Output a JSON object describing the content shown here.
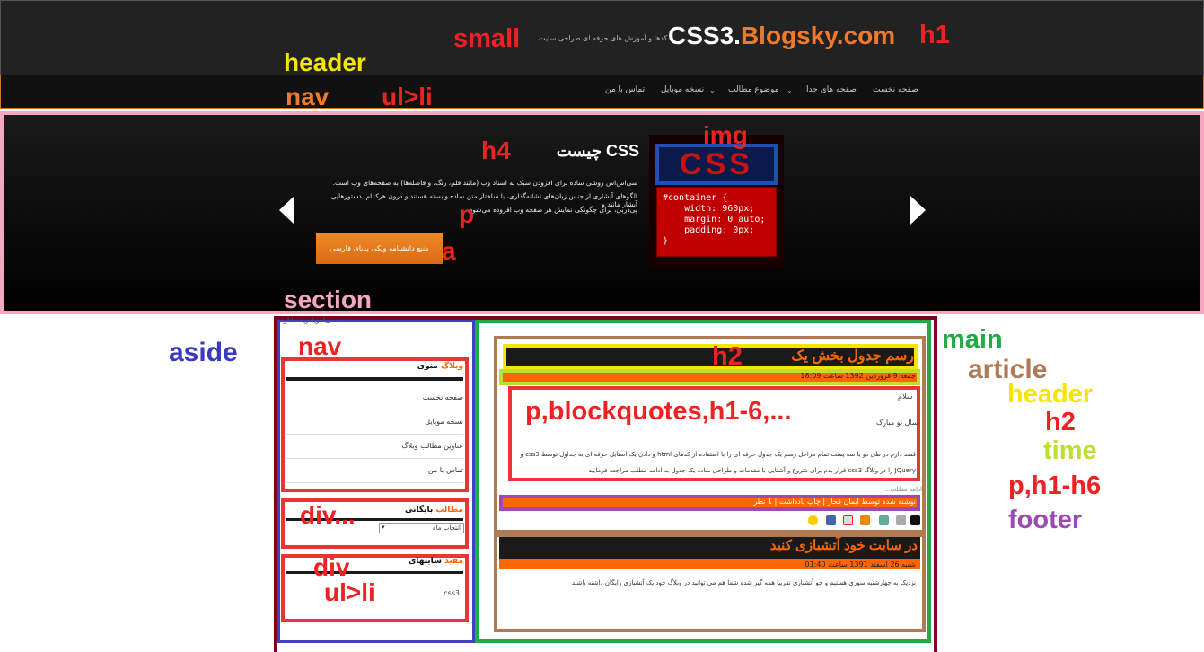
{
  "site": {
    "logo_css3": "CSS3.",
    "logo_blogsky": "Blogsky.com",
    "tagline": "کدها و آموزش های حرفه ای طراحی سایت",
    "nav": [
      {
        "label": "صفحه نخست"
      },
      {
        "label": "صفحه های جدا"
      },
      {
        "label": "موضوع مطالب"
      },
      {
        "label": "نسخه موبایل"
      },
      {
        "label": "تماس با من"
      }
    ]
  },
  "hero": {
    "title": "CSS چیست",
    "p1": "سی‌اس‌اس روشی ساده برای افزودن سبک به اسناد وب (مانند قلم، رنگ، و فاصله‌ها) به صفحه‌های وب است.",
    "p2": "الگوهای آبشاری از جنس زبان‌های نشانه‌گذاری، با ساختار متن ساده وابسته هستند و درون هرکدام، دستورهایی آبشار مانند و",
    "p3": "پی‌دربی، برای چگونگی نمایش هر صفحه وب افزوده می‌شود.",
    "button": "منبع دانشنامه ویکی پدیای فارسی",
    "code": "#container {\n    width: 960px;\n    margin: 0 auto;\n    padding: 0px;\n}",
    "img_text": "CSS"
  },
  "sidebar": {
    "top_text": "سی‌اس‌اس · دانلود",
    "menu_title_a": "منوی",
    "menu_title_b": "وبلاگ",
    "menu_items": [
      {
        "label": "صفحه نخست"
      },
      {
        "label": "نسخه موبایل"
      },
      {
        "label": "عناوین مطالب وبلاگ"
      },
      {
        "label": "تماس با من"
      }
    ],
    "archive_title_a": "بایگانی",
    "archive_title_b": "مطالب",
    "archive_select": "انتخاب ماه",
    "links_title_a": "سایتهای",
    "links_title_b": "مفید",
    "links_items": [
      {
        "label": "css3"
      }
    ]
  },
  "posts": [
    {
      "title": "رسم جدول بخش یک",
      "meta": "جمعه 9 فروردین 1392 ساعت 18:09",
      "lines": [
        "سلام",
        "سال نو مبارک",
        "قصد دارم در طی دو یا سه پست تمام مراحل رسم یک جدول حرفه ای را با استفاده از کدهای html و دادن یک استایل حرفه ای به جداول توسط css3 و",
        "JQuery را در وبلاگ css3 قرار بدم برای شروع و آشنایی با مقدمات و طراحی ساده یک جدول به ادامه مطلب مراجعه فرمایید"
      ],
      "more": "ادامه مطلب...",
      "footer": "نوشته شده توسط ایمان فخار | چاپ یادداشت | 1 نظر"
    },
    {
      "title": "در سایت خود آتشبازی کنید",
      "meta": "شنبه 26 اسفند 1391 ساعت 01:40",
      "lines": [
        "نزدیک به چهارشنبه سوری هستیم و جو آتشبازی تقریبا همه گیر شده شما هم می توانید در وبلاگ خود یک آتشبازی رایگان داشته باشید"
      ]
    }
  ],
  "annotations": {
    "small": "small",
    "h1": "h1",
    "header": "header",
    "nav": "nav",
    "ulli": "ul>li",
    "img": "img",
    "h4": "h4",
    "p": "p",
    "a": "a",
    "section": "section",
    "aside": "aside",
    "nav2": "nav",
    "h2": "h2",
    "pblock": "p,blockquotes,h1-6,...",
    "main": "main",
    "article": "article",
    "header2": "header",
    "h2b": "h2",
    "time": "time",
    "ph": "p,h1-h6",
    "footer": "footer",
    "div1": "div...",
    "div2": "div",
    "ulli2": "ul>li"
  },
  "colors": {
    "orange": "#f60",
    "label_red": "#ee2222",
    "label_yellow": "#f5e600",
    "label_orange": "#f07a2a",
    "label_blue": "#3a3ac0",
    "label_green": "#22aa44",
    "label_brown": "#b07a55",
    "label_lime": "#bde030",
    "label_purple": "#9a4ab0",
    "label_pink": "#f5a6c0"
  }
}
